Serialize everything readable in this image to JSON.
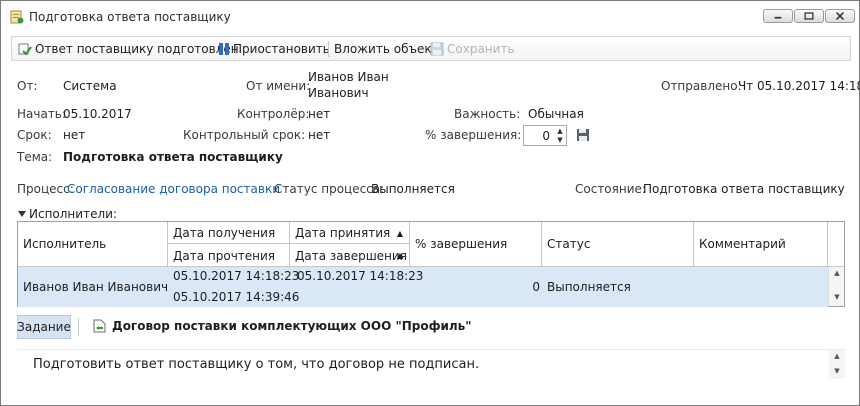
{
  "window": {
    "title": "Подготовка ответа поставщику"
  },
  "toolbar": {
    "prepared_label": "Ответ поставщику подготовлен",
    "pause_label": "Приостановить",
    "attach_label": "Вложить объект",
    "save_label": "Сохранить"
  },
  "fields": {
    "from_label": "От:",
    "from_value": "Система",
    "on_behalf_label": "От имени:",
    "on_behalf_value_line1": "Иванов Иван",
    "on_behalf_value_line2": "Иванович",
    "sent_label": "Отправлено:",
    "sent_value": "Чт 05.10.2017 14:18",
    "start_label": "Начать:",
    "start_value": "05.10.2017",
    "controller_label": "Контролёр:",
    "controller_value": "нет",
    "importance_label": "Важность:",
    "importance_value": "Обычная",
    "deadline_label": "Срок:",
    "deadline_value": "нет",
    "control_deadline_label": "Контрольный срок:",
    "control_deadline_value": "нет",
    "completion_label": "% завершения:",
    "completion_value": "0",
    "subject_label": "Тема:",
    "subject_value": "Подготовка ответа поставщику"
  },
  "process": {
    "process_label": "Процесс:",
    "process_value": "Согласование договора поставки",
    "status_label": "Статус процесса:",
    "status_value": "Выполняется",
    "state_label": "Состояние:",
    "state_value": "Подготовка ответа поставщику"
  },
  "executors": {
    "section_label": "Исполнители:",
    "columns": {
      "executor": "Исполнитель",
      "received": "Дата получения",
      "read": "Дата прочтения",
      "accepted": "Дата принятия",
      "completed": "Дата завершения",
      "percent": "% завершения",
      "status": "Статус",
      "comment": "Комментарий"
    },
    "rows": [
      {
        "executor": "Иванов Иван Иванович",
        "received": "05.10.2017 14:18:23",
        "read": "05.10.2017 14:39:46",
        "accepted": "05.10.2017 14:18:23",
        "completed": "",
        "percent": "0",
        "status": "Выполняется",
        "comment": ""
      }
    ]
  },
  "tabs": {
    "task_tab": "Задание",
    "document_link": "Договор поставки комплектующих ООО \"Профиль\""
  },
  "task": {
    "text": "Подготовить ответ поставщику о том, что договор не подписан."
  },
  "colors": {
    "row_selected": "#d9e7f7",
    "link": "#1a5ea8",
    "tab_active": "#d6e3f3"
  }
}
